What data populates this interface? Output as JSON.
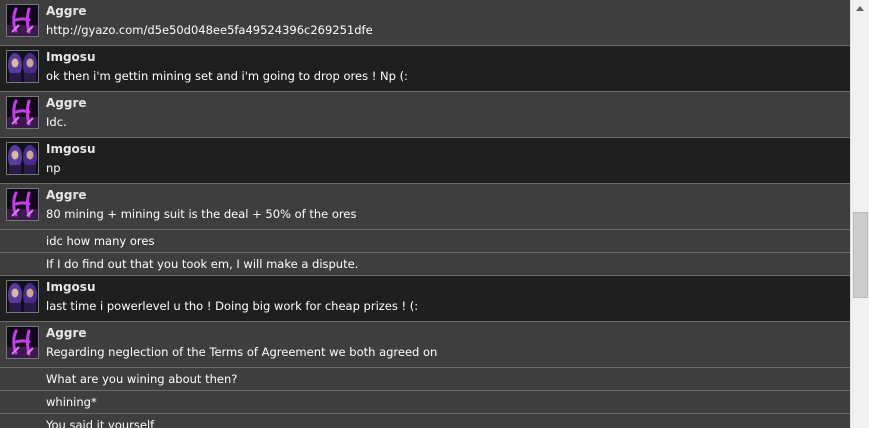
{
  "messages": [
    {
      "user": "Aggre",
      "theme": "light",
      "avatar": "aggre-avatar-icon",
      "lines": [
        "http://gyazo.com/d5e50d048ee5fa49524396c269251dfe"
      ]
    },
    {
      "user": "Imgosu",
      "theme": "dark",
      "avatar": "imgosu-avatar-icon",
      "lines": [
        "ok then i'm gettin mining set and i'm going to drop ores ! Np (:"
      ]
    },
    {
      "user": "Aggre",
      "theme": "light",
      "avatar": "aggre-avatar-icon",
      "lines": [
        "Idc."
      ]
    },
    {
      "user": "Imgosu",
      "theme": "dark",
      "avatar": "imgosu-avatar-icon",
      "lines": [
        "np"
      ]
    },
    {
      "user": "Aggre",
      "theme": "light",
      "avatar": "aggre-avatar-icon",
      "lines": [
        "80 mining + mining suit is the deal + 50% of the ores",
        "idc how many ores",
        "If I do find out that you took em, I will make a dispute."
      ]
    },
    {
      "user": "Imgosu",
      "theme": "dark",
      "avatar": "imgosu-avatar-icon",
      "lines": [
        "last time i powerlevel u tho ! Doing big work for cheap prizes ! (:"
      ]
    },
    {
      "user": "Aggre",
      "theme": "light",
      "avatar": "aggre-avatar-icon",
      "lines": [
        "Regarding neglection of the Terms of Agreement we both agreed on",
        "What are you wining about then?",
        "whining*",
        "You said it yourself"
      ]
    }
  ],
  "colors": {
    "light": "#3e3e3e",
    "dark": "#1f1f1f",
    "aggre_accent": "#b03ad8",
    "imgosu_hair": "#6a3aa8"
  }
}
